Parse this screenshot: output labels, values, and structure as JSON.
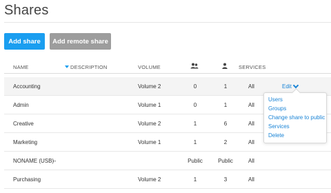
{
  "page": {
    "title": "Shares"
  },
  "toolbar": {
    "add_label": "Add share",
    "add_remote_label": "Add remote share"
  },
  "table": {
    "headers": {
      "name": "NAME",
      "description": "DESCRIPTION",
      "volume": "VOLUME",
      "group_users_icon": "group-users-icon",
      "user_icon": "user-icon",
      "services": "SERVICES"
    },
    "sorted_by": "name",
    "rows": [
      {
        "name": "Accounting",
        "description": "",
        "volume": "Volume 2",
        "col1": "0",
        "col2": "1",
        "services": "All",
        "selected": true
      },
      {
        "name": "Admin",
        "description": "",
        "volume": "Volume 1",
        "col1": "0",
        "col2": "1",
        "services": "All"
      },
      {
        "name": "Creative",
        "description": "",
        "volume": "Volume 2",
        "col1": "1",
        "col2": "6",
        "services": "All"
      },
      {
        "name": "Marketing",
        "description": "",
        "volume": "Volume 1",
        "col1": "1",
        "col2": "2",
        "services": "All"
      },
      {
        "name": "NONAME (USB)",
        "description": "--",
        "volume": "",
        "col1": "Public",
        "col2": "Public",
        "services": "All"
      },
      {
        "name": "Purchasing",
        "description": "",
        "volume": "Volume 2",
        "col1": "1",
        "col2": "3",
        "services": "All"
      }
    ]
  },
  "edit": {
    "label": "Edit"
  },
  "edit_menu": {
    "items": [
      "Users",
      "Groups",
      "Change share to public",
      "Services",
      "Delete"
    ]
  },
  "colors": {
    "accent": "#1a9ef0",
    "link": "#1a84d6",
    "secondary_button": "#9d9d9d",
    "selected_row": "#f4f4f4"
  }
}
